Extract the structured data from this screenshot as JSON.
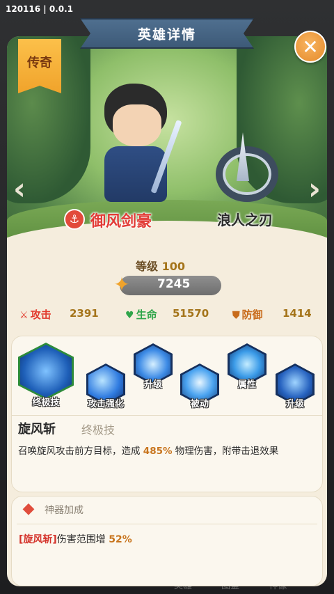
{
  "version_text": "120116 | 0.0.1",
  "title": "英雄详情",
  "close_icon": "close-icon",
  "rarity": "传奇",
  "hero": {
    "name": "御风剑豪",
    "class_icon": "anchor-icon",
    "weapon_name": "浪人之刃",
    "level_label": "等级",
    "level_value": "100",
    "power_value": "7245"
  },
  "stats": {
    "atk": {
      "label": "攻击",
      "value": "2391",
      "color": "#e2392c"
    },
    "hp": {
      "label": "生命",
      "value": "51570",
      "color": "#2fa54a"
    },
    "def": {
      "label": "防御",
      "value": "1414",
      "color": "#c86b1b"
    }
  },
  "skills": [
    {
      "label": "终极技",
      "icon": "whirlwind-icon",
      "selected": true
    },
    {
      "label": "攻击强化",
      "icon": "wind-slash-icon"
    },
    {
      "label": "升级",
      "icon": "wave-icon"
    },
    {
      "label": "被动",
      "icon": "spirit-icon"
    },
    {
      "label": "属性",
      "icon": "flame-icon"
    },
    {
      "label": "升级",
      "icon": "helmet-icon"
    }
  ],
  "skill_detail": {
    "name": "旋风斩",
    "type": "终极技",
    "desc_pre": "召唤旋风攻击前方目标，造成 ",
    "desc_pct": "485%",
    "desc_post": " 物理伤害，附带击退效果"
  },
  "artifact": {
    "title": "神器加成",
    "skill_ref": "[旋风斩]",
    "effect": "伤害范围增 ",
    "pct": "52%"
  },
  "bottom_tabs": [
    "英雄",
    "图鉴",
    "神像"
  ]
}
